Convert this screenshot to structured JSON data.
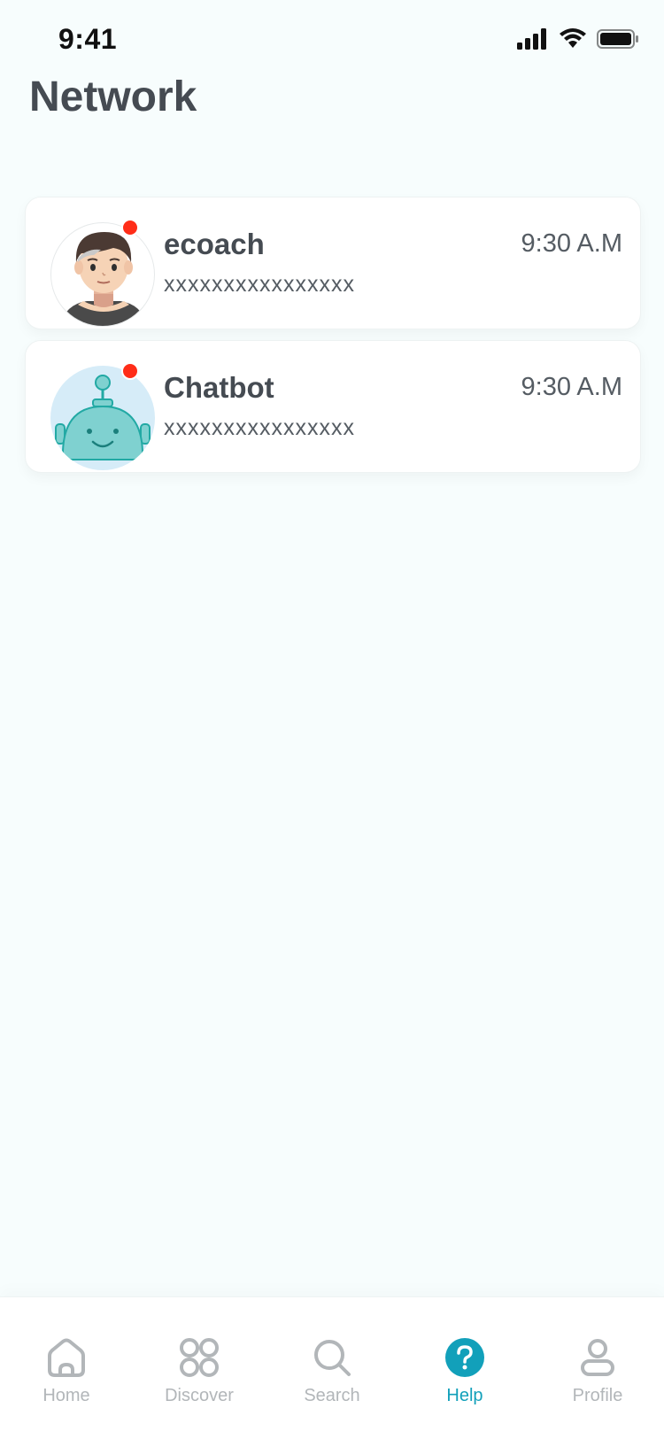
{
  "status_bar": {
    "time": "9:41"
  },
  "header": {
    "title": "Network"
  },
  "chats": [
    {
      "name": "ecoach",
      "time": "9:30 A.M",
      "preview": "xxxxxxxxxxxxxxxx",
      "avatar": "person-avatar",
      "unread": true
    },
    {
      "name": "Chatbot",
      "time": "9:30 A.M",
      "preview": "xxxxxxxxxxxxxxxx",
      "avatar": "robot-avatar",
      "unread": true
    }
  ],
  "tab_bar": {
    "tabs": [
      {
        "label": "Home",
        "icon": "home-icon",
        "active": false
      },
      {
        "label": "Discover",
        "icon": "grid-icon",
        "active": false
      },
      {
        "label": "Search",
        "icon": "search-icon",
        "active": false
      },
      {
        "label": "Help",
        "icon": "help-icon",
        "active": true
      },
      {
        "label": "Profile",
        "icon": "person-icon",
        "active": false
      }
    ]
  },
  "colors": {
    "accent": "#12a0ba",
    "unread": "#ff2d18",
    "background": "#f7fdfd",
    "text": "#454b52"
  }
}
